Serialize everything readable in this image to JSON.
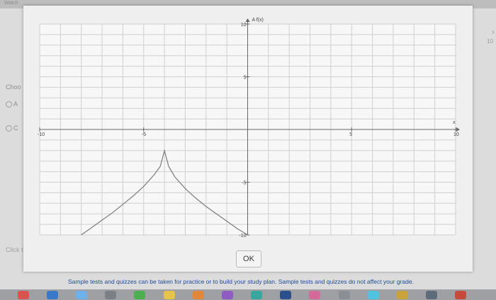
{
  "background": {
    "top_left_text": "Watch",
    "left_label": "Choo",
    "option_a": "A",
    "option_c": "C",
    "click_text": "Click t",
    "right_axis_label": "10"
  },
  "dialog": {
    "ok_label": "OK"
  },
  "footer": {
    "notice": "Sample tests and quizzes can be taken for practice or to build your study plan. Sample tests and quizzes do not affect your grade."
  },
  "dock_icons": [
    {
      "name": "dock-icon-red",
      "color": "#d9534f"
    },
    {
      "name": "dock-icon-blue",
      "color": "#3a78c9"
    },
    {
      "name": "dock-icon-lightblue",
      "color": "#6fb0e8"
    },
    {
      "name": "dock-icon-gray",
      "color": "#7b8086"
    },
    {
      "name": "dock-icon-green",
      "color": "#4caf50"
    },
    {
      "name": "dock-icon-yellow",
      "color": "#e6c34a"
    },
    {
      "name": "dock-icon-orange",
      "color": "#e0873a"
    },
    {
      "name": "dock-icon-purple",
      "color": "#8e5bc2"
    },
    {
      "name": "dock-icon-teal",
      "color": "#3aa6a0"
    },
    {
      "name": "dock-icon-darkblue",
      "color": "#2b4f8a"
    },
    {
      "name": "dock-icon-pink",
      "color": "#d46a9a"
    },
    {
      "name": "dock-icon-gray2",
      "color": "#8a8f96"
    },
    {
      "name": "dock-icon-cyan",
      "color": "#4fc3e0"
    },
    {
      "name": "dock-icon-gold",
      "color": "#c9a23c"
    },
    {
      "name": "dock-icon-slate",
      "color": "#5d6b7a"
    },
    {
      "name": "dock-icon-red2",
      "color": "#c74b3c"
    }
  ],
  "chart_data": {
    "type": "line",
    "title": "",
    "xlabel": "x",
    "ylabel": "A f(x)",
    "xlim": [
      -10,
      10
    ],
    "ylim": [
      -10,
      10
    ],
    "grid": true,
    "x_ticks": [
      -10,
      -5,
      5,
      10
    ],
    "y_ticks": [
      10,
      5,
      -5,
      -10
    ],
    "x_tick_labels": [
      "-10",
      "-5",
      "5",
      "10"
    ],
    "y_tick_labels": [
      "10",
      "5",
      "-5",
      "-10"
    ],
    "series": [
      {
        "x": [
          -8,
          -7.5,
          -7,
          -6.5,
          -6,
          -5.5,
          -5,
          -4.5,
          -4.2,
          -4,
          -3.8,
          -3.5,
          -3,
          -2.5,
          -2,
          -1.5,
          -1,
          -0.5,
          0
        ],
        "y": [
          -10,
          -9.3,
          -8.6,
          -7.9,
          -7.1,
          -6.3,
          -5.4,
          -4.3,
          -3.5,
          -2.0,
          -3.5,
          -4.5,
          -5.6,
          -6.5,
          -7.3,
          -8.0,
          -8.7,
          -9.4,
          -10
        ],
        "color": "#7c7c7c"
      }
    ]
  }
}
